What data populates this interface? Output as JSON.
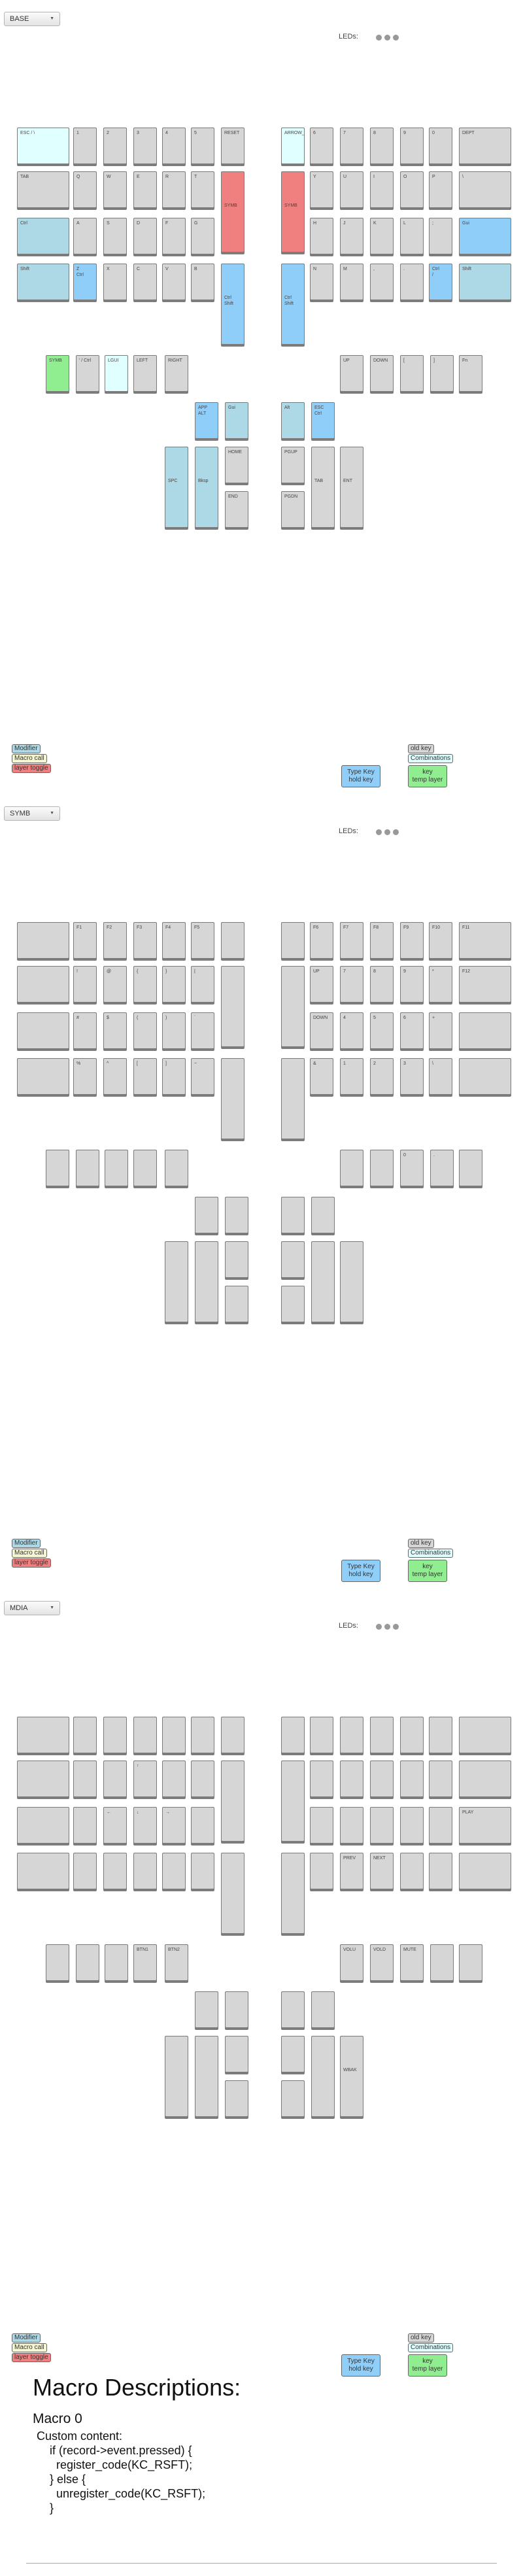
{
  "leds_label": "LEDs:",
  "legend": {
    "modifier": "Modifier",
    "macro": "Macro call",
    "layer_toggle": "layer toggle",
    "old_key": "old key",
    "combinations": "Combinations",
    "dual": "Type Key\nhold key",
    "key_temp": "key\ntemp layer"
  },
  "layers": [
    {
      "name": "BASE",
      "keys": {
        "l0": [
          "ESC / \\",
          "1",
          "2",
          "3",
          "4",
          "5",
          "RESET"
        ],
        "l1": [
          "TAB",
          "Q",
          "W",
          "E",
          "R",
          "T",
          "SYMB"
        ],
        "l2": [
          "Ctrl",
          "A",
          "S",
          "D",
          "F",
          "G"
        ],
        "l3": [
          "Shift",
          "Z\nCtrl",
          "X",
          "C",
          "V",
          "B",
          "Ctrl\nShift"
        ],
        "l4": [
          "SYMB",
          "' / Ctrl",
          "LGUI",
          "LEFT",
          "RIGHT"
        ],
        "lt": [
          "APP\nALT",
          "Gui",
          "HOME",
          "SPC",
          "Bksp",
          "END"
        ],
        "r0": [
          "ARROW_...",
          "6",
          "7",
          "8",
          "9",
          "0",
          "DEPT"
        ],
        "r1": [
          "SYMB",
          "Y",
          "U",
          "I",
          "O",
          "P",
          "\\"
        ],
        "r2": [
          "H",
          "J",
          "K",
          "L",
          ";",
          "Gui"
        ],
        "r3": [
          "Ctrl\nShift",
          "N",
          "M",
          ",",
          ".",
          "Ctrl\n/",
          "Shift"
        ],
        "r4": [
          "UP",
          "DOWN",
          "[",
          "]",
          "Fn"
        ],
        "rt": [
          "Alt",
          "ESC\nCtrl",
          "PGUP",
          "PGDN",
          "TAB",
          "ENT"
        ]
      },
      "colors": {
        "l0": [
          "sys",
          "",
          "",
          "",
          "",
          "",
          ""
        ],
        "l1": [
          "",
          "",
          "",
          "",
          "",
          "",
          "lt"
        ],
        "l2": [
          "mod",
          "",
          "",
          "",
          "",
          ""
        ],
        "l3": [
          "mod",
          "bt",
          "",
          "",
          "",
          "",
          "bt"
        ],
        "l4": [
          "gr",
          "",
          "sys",
          "",
          ""
        ],
        "lt": [
          "bt",
          "mod",
          "",
          "mod",
          "mod",
          ""
        ],
        "r0": [
          "sys",
          "",
          "",
          "",
          "",
          "",
          ""
        ],
        "r1": [
          "lt",
          "",
          "",
          "",
          "",
          "",
          ""
        ],
        "r2": [
          "",
          "",
          "",
          "",
          "",
          "bt"
        ],
        "r3": [
          "bt",
          "",
          "",
          "",
          "",
          "bt",
          "mod"
        ],
        "r4": [
          "",
          "",
          "",
          "",
          ""
        ],
        "rt": [
          "mod",
          "bt",
          "",
          "",
          "",
          ""
        ]
      }
    },
    {
      "name": "SYMB",
      "keys": {
        "l0": [
          "",
          "F1",
          "F2",
          "F3",
          "F4",
          "F5",
          ""
        ],
        "l1": [
          "",
          "!",
          "@",
          "{",
          "}",
          "|",
          ""
        ],
        "l2": [
          "",
          "#",
          "$",
          "(",
          ")",
          "`"
        ],
        "l3": [
          "",
          "%",
          "^",
          "[",
          "]",
          "~",
          ""
        ],
        "l4": [
          "",
          "",
          "",
          "",
          ""
        ],
        "lt": [
          "",
          "",
          "",
          "",
          "",
          ""
        ],
        "r0": [
          "",
          "F6",
          "F7",
          "F8",
          "F9",
          "F10",
          "F11"
        ],
        "r1": [
          "",
          "UP",
          "7",
          "8",
          "9",
          "*",
          "F12"
        ],
        "r2": [
          "DOWN",
          "4",
          "5",
          "6",
          "+",
          ""
        ],
        "r3": [
          "",
          "&",
          "1",
          "2",
          "3",
          "\\",
          ""
        ],
        "r4": [
          "",
          "",
          "0",
          ".",
          ""
        ],
        "rt": [
          "",
          "",
          "",
          "",
          "",
          ""
        ]
      }
    },
    {
      "name": "MDIA",
      "keys": {
        "l0": [
          "",
          "",
          "",
          "",
          "",
          "",
          ""
        ],
        "l1": [
          "",
          "",
          "",
          "↑",
          "",
          "",
          ""
        ],
        "l2": [
          "",
          "",
          "←",
          "↓",
          "→",
          ""
        ],
        "l3": [
          "",
          "",
          "",
          "",
          "",
          "",
          ""
        ],
        "l4": [
          "",
          "",
          "",
          "BTN1",
          "BTN2"
        ],
        "lt": [
          "",
          "",
          "",
          "",
          "",
          ""
        ],
        "r0": [
          "",
          "",
          "",
          "",
          "",
          "",
          ""
        ],
        "r1": [
          "",
          "",
          "",
          "",
          "",
          "",
          ""
        ],
        "r2": [
          "",
          "",
          "",
          "",
          "",
          "PLAY"
        ],
        "r3": [
          "",
          "",
          "PREV",
          "NEXT",
          "",
          "",
          ""
        ],
        "r4": [
          "VOLU",
          "VOLD",
          "MUTE",
          "",
          ""
        ],
        "rt": [
          "",
          "",
          "",
          "",
          "",
          "WBAK"
        ]
      }
    }
  ],
  "macros": {
    "title": "Macro Descriptions:",
    "name": "Macro 0",
    "code": "Custom content:\n    if (record->event.pressed) {\n      register_code(KC_RSFT);\n    } else {\n      unregister_code(KC_RSFT);\n    }"
  }
}
